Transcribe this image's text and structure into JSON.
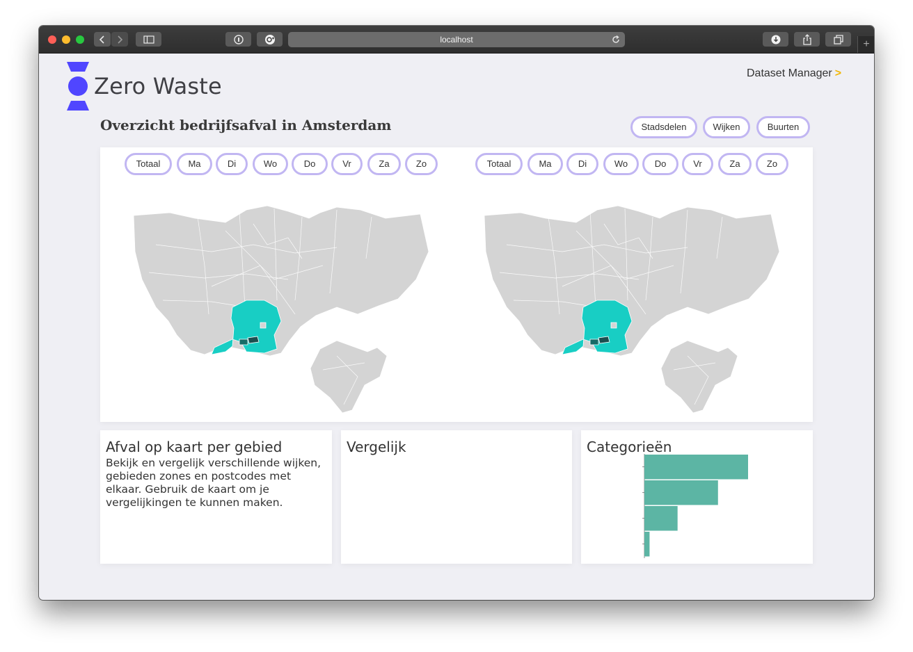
{
  "browser": {
    "url": "localhost"
  },
  "header": {
    "brand": "Zero Waste",
    "dataset_manager": "Dataset Manager",
    "dataset_manager_arrow": ">"
  },
  "page_title": "Overzicht bedrijfsafval in Amsterdam",
  "area_levels": [
    "Stadsdelen",
    "Wijken",
    "Buurten"
  ],
  "day_filters": [
    "Totaal",
    "Ma",
    "Di",
    "Wo",
    "Do",
    "Vr",
    "Za",
    "Zo"
  ],
  "colors": {
    "accent": "#5046ff",
    "pill_border": "#c1b6f2",
    "map_base": "#d4d4d4",
    "map_highlight": "#18cec4",
    "map_selected": "#1a4f4f",
    "bar": "#5cb5a4",
    "background": "#efeff4"
  },
  "cards": {
    "info": {
      "title": "Afval op kaart per gebied",
      "text": "Bekijk en vergelijk verschillende wijken, gebieden zones en postcodes met elkaar. Gebruik de kaart om je vergelijkingen te kunnen maken."
    },
    "compare": {
      "title": "Vergelijk"
    },
    "categories": {
      "title": "Categorieën"
    }
  },
  "chart_data": {
    "type": "bar",
    "orientation": "horizontal",
    "categories": [
      "",
      "",
      "",
      ""
    ],
    "values": [
      100,
      71,
      32,
      5
    ],
    "xlim": [
      0,
      100
    ]
  }
}
